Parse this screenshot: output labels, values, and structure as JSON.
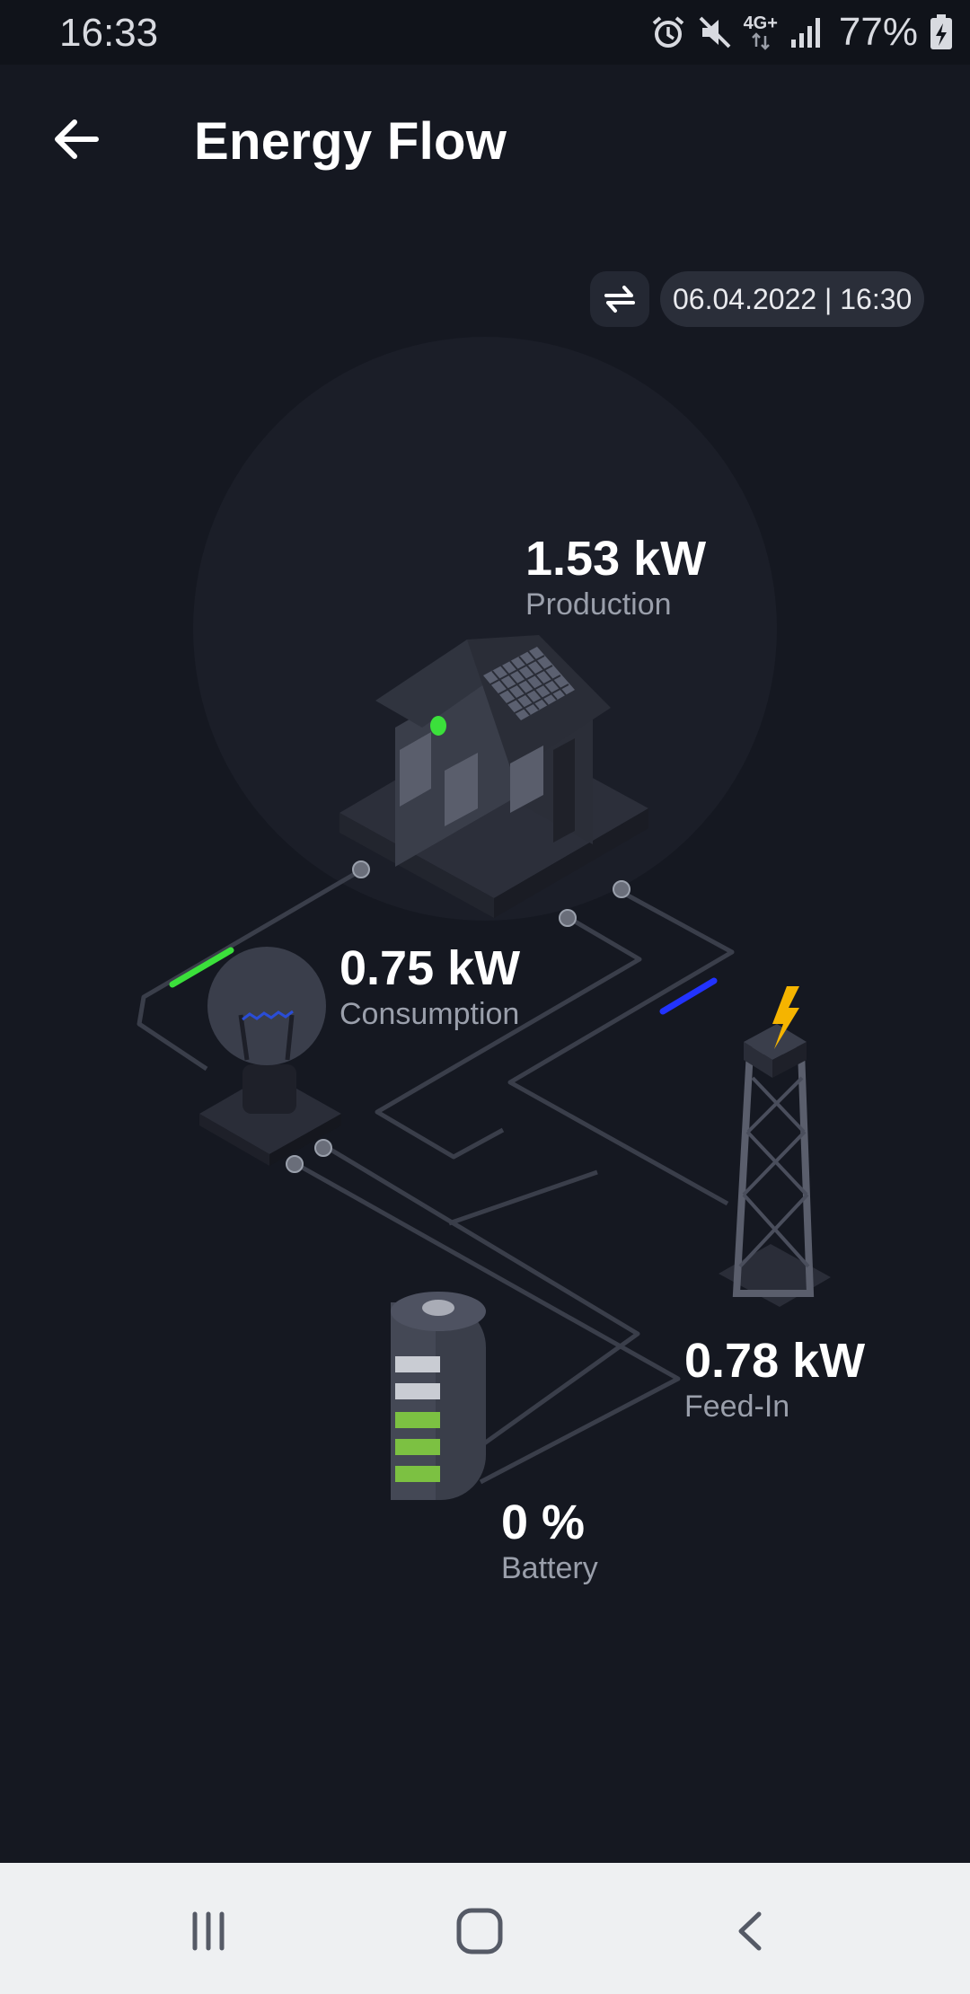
{
  "status_bar": {
    "time": "16:33",
    "network": "4G+",
    "battery": "77%",
    "icons": [
      "alarm-icon",
      "mute-icon",
      "network-4g-icon",
      "signal-icon",
      "battery-charging-icon"
    ]
  },
  "header": {
    "title": "Energy Flow",
    "back_icon": "arrow-left-icon"
  },
  "toolbar": {
    "refresh_icon": "swap-arrows-icon",
    "date": "06.04.2022 | 16:30"
  },
  "metrics": {
    "production": {
      "value": "1.53 kW",
      "label": "Production"
    },
    "consumption": {
      "value": "0.75 kW",
      "label": "Consumption"
    },
    "feed_in": {
      "value": "0.78 kW",
      "label": "Feed-In"
    },
    "battery": {
      "value": "0 %",
      "label": "Battery"
    }
  },
  "colors": {
    "background": "#151821",
    "consumption_flow": "#3be03b",
    "feed_in_flow": "#2233ff",
    "bolt": "#f5b400",
    "battery_fill": "#7cc142"
  },
  "nav_bar": {
    "icons": [
      "recent-apps-icon",
      "home-icon",
      "back-icon"
    ]
  }
}
